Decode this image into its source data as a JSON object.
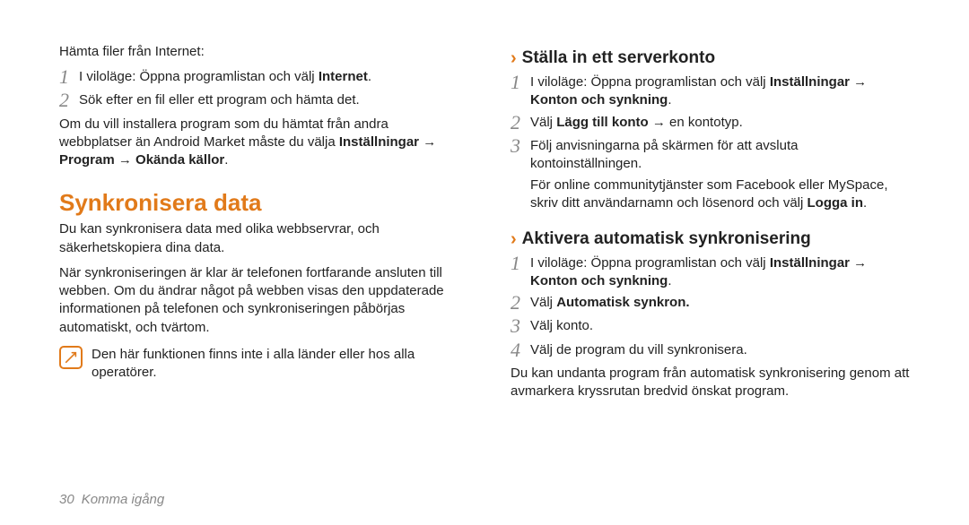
{
  "left": {
    "intro": "Hämta filer från Internet:",
    "steps": [
      {
        "num": "1",
        "pre": "I viloläge: Öppna programlistan och välj ",
        "b1": "Internet",
        "post": "."
      },
      {
        "num": "2",
        "pre": "Sök efter en fil eller ett program och hämta det.",
        "b1": "",
        "post": ""
      }
    ],
    "after_pre": "Om du vill installera program som du hämtat från andra webbplatser än Android Market måste du välja ",
    "after_b1": "Inställningar",
    "after_arrow1": " → ",
    "after_b2": "Program",
    "after_arrow2": " → ",
    "after_b3": "Okända källor",
    "after_post": ".",
    "h1": "Synkronisera data",
    "sync_p1": "Du kan synkronisera data med olika webbservrar, och säkerhetskopiera dina data.",
    "sync_p2": "När synkroniseringen är klar är telefonen fortfarande ansluten till webben. Om du ändrar något på webben visas den uppdaterade informationen på telefonen och synkroniseringen påbörjas automatiskt, och tvärtom.",
    "note": "Den här funktionen finns inte i alla länder eller hos alla operatörer."
  },
  "right": {
    "h2a": "Ställa in ett serverkonto",
    "a_steps": [
      {
        "num": "1",
        "pre": "I viloläge: Öppna programlistan och välj ",
        "b1": "Inställningar",
        "mid": " → ",
        "b2": "Konton och synkning",
        "post": "."
      },
      {
        "num": "2",
        "pre": "Välj ",
        "b1": "Lägg till konto",
        "mid": " → en kontotyp.",
        "b2": "",
        "post": ""
      },
      {
        "num": "3",
        "pre": "Följ anvisningarna på skärmen för att avsluta kontoinställningen.",
        "b1": "",
        "mid": "",
        "b2": "",
        "post": ""
      }
    ],
    "a_after_pre": "För online communitytjänster som Facebook eller MySpace, skriv ditt användarnamn och lösenord och välj ",
    "a_after_b": "Logga in",
    "a_after_post": ".",
    "h2b": "Aktivera automatisk synkronisering",
    "b_steps": [
      {
        "num": "1",
        "pre": "I viloläge: Öppna programlistan och välj ",
        "b1": "Inställningar",
        "mid": " → ",
        "b2": "Konton och synkning",
        "post": "."
      },
      {
        "num": "2",
        "pre": "Välj ",
        "b1": "Automatisk synkron.",
        "mid": "",
        "b2": "",
        "post": ""
      },
      {
        "num": "3",
        "pre": "Välj konto.",
        "b1": "",
        "mid": "",
        "b2": "",
        "post": ""
      },
      {
        "num": "4",
        "pre": "Välj de program du vill synkronisera.",
        "b1": "",
        "mid": "",
        "b2": "",
        "post": ""
      }
    ],
    "b_after": "Du kan undanta program från automatisk synkronisering genom att avmarkera kryssrutan bredvid önskat program."
  },
  "footer": {
    "page": "30",
    "section": "Komma igång"
  }
}
